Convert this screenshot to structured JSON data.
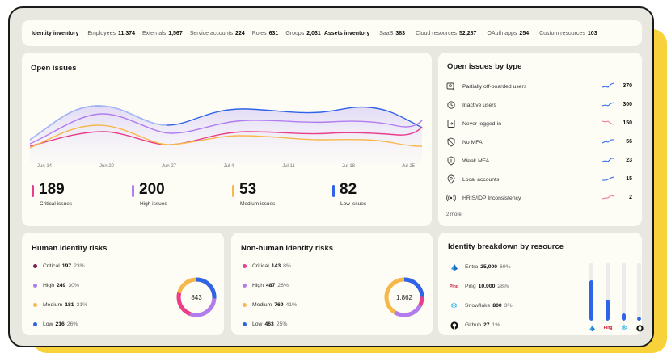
{
  "inventory": {
    "identity_title": "Identity inventory",
    "items": [
      {
        "label": "Employees",
        "value": "11,374"
      },
      {
        "label": "Externals",
        "value": "1,567"
      },
      {
        "label": "Service accounts",
        "value": "224"
      },
      {
        "label": "Roles",
        "value": "631"
      },
      {
        "label": "Groups",
        "value": "2,031"
      }
    ],
    "assets_title": "Assets inventory",
    "assets": [
      {
        "label": "SaaS",
        "value": "383"
      },
      {
        "label": "Cloud resources",
        "value": "52,287"
      },
      {
        "label": "OAuth apps",
        "value": "254"
      },
      {
        "label": "Custom resources",
        "value": "103"
      }
    ]
  },
  "open_issues": {
    "title": "Open issues",
    "dates": [
      "Jun 14",
      "Jun 20",
      "Jun 27",
      "Jul 4",
      "Jul 11",
      "Jul 18",
      "Jul 25"
    ],
    "stats": [
      {
        "value": "189",
        "label": "Critical issues",
        "color": "#e83e8c"
      },
      {
        "value": "200",
        "label": "High issues",
        "color": "#b07cf0"
      },
      {
        "value": "53",
        "label": "Medium issues",
        "color": "#f7b84b"
      },
      {
        "value": "82",
        "label": "Low issues",
        "color": "#2f63e8"
      }
    ]
  },
  "issues_by_type": {
    "title": "Open issues by type",
    "rows": [
      {
        "label": "Partially off-boarded users",
        "value": "370",
        "icon": "user-off-icon",
        "trend": "up"
      },
      {
        "label": "Inactive users",
        "value": "300",
        "icon": "user-clock-icon",
        "trend": "up"
      },
      {
        "label": "Never logged-in",
        "value": "150",
        "icon": "login-icon",
        "trend": "down"
      },
      {
        "label": "No MFA",
        "value": "56",
        "icon": "shield-off-icon",
        "trend": "up"
      },
      {
        "label": "Weak MFA",
        "value": "23",
        "icon": "shield-alert-icon",
        "trend": "up"
      },
      {
        "label": "Local accounts",
        "value": "15",
        "icon": "location-icon",
        "trend": "up"
      },
      {
        "label": "HRIS/IDP Inconsistency",
        "value": "2",
        "icon": "broadcast-icon",
        "trend": "up-pink"
      }
    ],
    "more": "2 more"
  },
  "human_risks": {
    "title": "Human identity risks",
    "total": "843",
    "rows": [
      {
        "label": "Critical",
        "value": "197",
        "pct": "23%",
        "color": "#7a1f4a"
      },
      {
        "label": "High",
        "value": "249",
        "pct": "30%",
        "color": "#b07cf0"
      },
      {
        "label": "Medium",
        "value": "181",
        "pct": "21%",
        "color": "#f7b84b"
      },
      {
        "label": "Low",
        "value": "216",
        "pct": "26%",
        "color": "#2f63e8"
      }
    ]
  },
  "nonhuman_risks": {
    "title": "Non-human identity risks",
    "total": "1,862",
    "rows": [
      {
        "label": "Critical",
        "value": "143",
        "pct": "8%",
        "color": "#e83e8c"
      },
      {
        "label": "High",
        "value": "487",
        "pct": "26%",
        "color": "#b07cf0"
      },
      {
        "label": "Medium",
        "value": "769",
        "pct": "41%",
        "color": "#f7b84b"
      },
      {
        "label": "Low",
        "value": "463",
        "pct": "25%",
        "color": "#2f63e8"
      }
    ]
  },
  "breakdown": {
    "title": "Identity breakdown by resource",
    "rows": [
      {
        "label": "Entra",
        "value": "25,000",
        "pct": "69%",
        "fraction": 0.69,
        "icon": "entra-icon"
      },
      {
        "label": "Ping",
        "value": "10,000",
        "pct": "28%",
        "fraction": 0.36,
        "icon": "ping-icon"
      },
      {
        "label": "Snowflake",
        "value": "800",
        "pct": "3%",
        "fraction": 0.12,
        "icon": "snowflake-icon"
      },
      {
        "label": "Github",
        "value": "27",
        "pct": "1%",
        "fraction": 0.06,
        "icon": "github-icon"
      }
    ],
    "ping_logo_text": "Ping"
  }
}
